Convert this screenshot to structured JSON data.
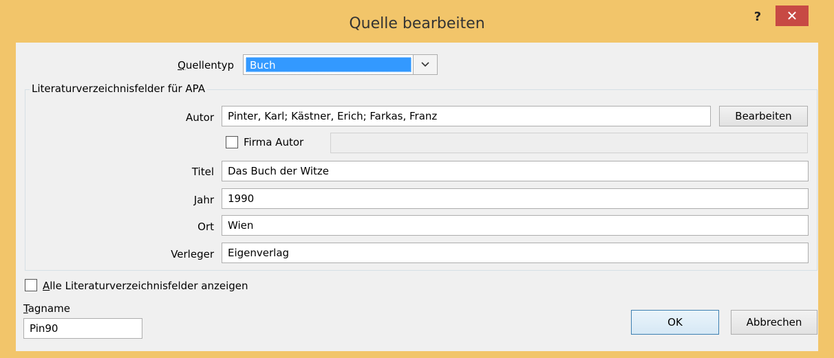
{
  "window": {
    "title": "Quelle bearbeiten",
    "help_label": "?",
    "close_label": "✕"
  },
  "source_type": {
    "label_accel": "Q",
    "label_rest": "uellentyp",
    "value": "Buch"
  },
  "fields_group": {
    "legend": "Literaturverzeichnisfelder für APA",
    "author": {
      "label": "Autor",
      "value": "Pinter, Karl; Kästner, Erich; Farkas, Franz",
      "edit_button": "Bearbeiten"
    },
    "corporate_author": {
      "label": "Firma Autor",
      "value": ""
    },
    "title": {
      "label": "Titel",
      "value": "Das Buch der Witze"
    },
    "year": {
      "label": "Jahr",
      "value": "1990"
    },
    "city": {
      "label": "Ort",
      "value": "Wien"
    },
    "publisher": {
      "label": "Verleger",
      "value": "Eigenverlag"
    }
  },
  "show_all": {
    "label_accel": "A",
    "label_rest": "lle Literaturverzeichnisfelder anzeigen"
  },
  "tag": {
    "label_accel": "T",
    "label_rest": "agname",
    "value": "Pin90"
  },
  "buttons": {
    "ok": "OK",
    "cancel": "Abbrechen"
  }
}
